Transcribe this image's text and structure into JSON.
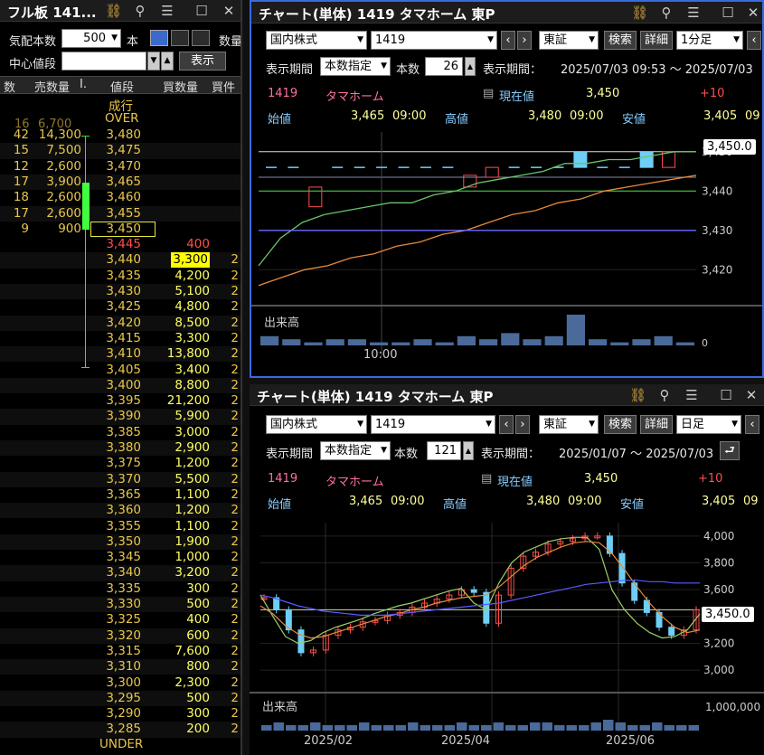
{
  "orderbook": {
    "title": "フル板 141...",
    "qty_label": "気配本数",
    "qty_value": "500",
    "unit_label": "本",
    "quantity_label": "数量",
    "center_label": "中心値段",
    "center_input": "",
    "display_button": "表示",
    "headers": [
      "数",
      "売数量",
      "I.",
      "値段",
      "買数量",
      "買件"
    ],
    "market_order_label": "成行",
    "over_label": "OVER",
    "under_label": "UNDER",
    "top_row": {
      "count": "16",
      "qty": "6,700"
    },
    "sell_rows": [
      {
        "count": "42",
        "qty": "14,300",
        "price": "3,480"
      },
      {
        "count": "15",
        "qty": "7,500",
        "price": "3,475"
      },
      {
        "count": "12",
        "qty": "2,600",
        "price": "3,470"
      },
      {
        "count": "17",
        "qty": "3,900",
        "price": "3,465"
      },
      {
        "count": "18",
        "qty": "2,600",
        "price": "3,460"
      },
      {
        "count": "17",
        "qty": "2,600",
        "price": "3,455"
      },
      {
        "count": "9",
        "qty": "900",
        "price": "3,450"
      }
    ],
    "buy_rows": [
      {
        "price": "3,445",
        "qty": "400"
      },
      {
        "price": "3,440",
        "qty": "3,300"
      },
      {
        "price": "3,435",
        "qty": "4,200"
      },
      {
        "price": "3,430",
        "qty": "5,100"
      },
      {
        "price": "3,425",
        "qty": "4,800"
      },
      {
        "price": "3,420",
        "qty": "8,500"
      },
      {
        "price": "3,415",
        "qty": "3,300"
      },
      {
        "price": "3,410",
        "qty": "13,800"
      },
      {
        "price": "3,405",
        "qty": "3,400"
      },
      {
        "price": "3,400",
        "qty": "8,800"
      },
      {
        "price": "3,395",
        "qty": "21,200"
      },
      {
        "price": "3,390",
        "qty": "5,900"
      },
      {
        "price": "3,385",
        "qty": "3,000"
      },
      {
        "price": "3,380",
        "qty": "2,900"
      },
      {
        "price": "3,375",
        "qty": "1,200"
      },
      {
        "price": "3,370",
        "qty": "5,500"
      },
      {
        "price": "3,365",
        "qty": "1,100"
      },
      {
        "price": "3,360",
        "qty": "1,200"
      },
      {
        "price": "3,355",
        "qty": "1,100"
      },
      {
        "price": "3,350",
        "qty": "1,900"
      },
      {
        "price": "3,345",
        "qty": "1,000"
      },
      {
        "price": "3,340",
        "qty": "3,200"
      },
      {
        "price": "3,335",
        "qty": "300"
      },
      {
        "price": "3,330",
        "qty": "500"
      },
      {
        "price": "3,325",
        "qty": "400"
      },
      {
        "price": "3,320",
        "qty": "600"
      },
      {
        "price": "3,315",
        "qty": "7,600"
      },
      {
        "price": "3,310",
        "qty": "800"
      },
      {
        "price": "3,300",
        "qty": "2,300"
      },
      {
        "price": "3,295",
        "qty": "500"
      },
      {
        "price": "3,290",
        "qty": "300"
      },
      {
        "price": "3,285",
        "qty": "200"
      }
    ]
  },
  "chart1": {
    "title": "チャート(単体) 1419 タマホーム 東P",
    "market": "国内株式",
    "code": "1419",
    "exchange": "東証",
    "search_btn": "検索",
    "detail_btn": "詳細",
    "interval": "1分足",
    "period_label": "表示期間",
    "period_mode": "本数指定",
    "count_label": "本数",
    "count_value": "26",
    "range_label": "表示期間：",
    "range_value": "2025/07/03 09:53 ～ 2025/07/03",
    "stock_code": "1419",
    "stock_name": "タマホーム",
    "current_label": "現在値",
    "current_value": "3,450",
    "change": "+10",
    "open_label": "始値",
    "open_value": "3,465",
    "open_time": "09:00",
    "high_label": "高値",
    "high_value": "3,480",
    "high_time": "09:00",
    "low_label": "安値",
    "low_value": "3,405",
    "low_time": "09",
    "price_tag": "3,450.0",
    "volume_label": "出来高",
    "time_label": "10:00"
  },
  "chart2": {
    "title": "チャート(単体) 1419 タマホーム 東P",
    "market": "国内株式",
    "code": "1419",
    "exchange": "東証",
    "search_btn": "検索",
    "detail_btn": "詳細",
    "interval": "日足",
    "period_label": "表示期間",
    "period_mode": "本数指定",
    "count_label": "本数",
    "count_value": "121",
    "range_label": "表示期間：",
    "range_value": "2025/01/07 ～ 2025/07/03",
    "stock_code": "1419",
    "stock_name": "タマホーム",
    "current_label": "現在値",
    "current_value": "3,450",
    "change": "+10",
    "open_label": "始値",
    "open_value": "3,465",
    "open_time": "09:00",
    "high_label": "高値",
    "high_value": "3,480",
    "high_time": "09:00",
    "low_label": "安値",
    "low_value": "3,405",
    "low_time": "09",
    "price_tag": "3,450.0",
    "volume_label": "出来高",
    "volume_tick": "1,000,000",
    "x_ticks": [
      "2025/02",
      "2025/04",
      "2025/06"
    ]
  },
  "colors": {
    "sell": "#e8c64a",
    "buy": "#ffff66",
    "up": "#ff4d4d",
    "down": "#6ecff6",
    "accent": "#ff6fa0"
  },
  "chart_data": [
    {
      "type": "line",
      "title": "",
      "ylim": [
        3415,
        3455
      ],
      "y_ticks": [
        3420,
        3430,
        3440,
        3450
      ],
      "x_tick_labels": [
        "10:00"
      ],
      "grid": true,
      "candles": [
        {
          "o": 3446,
          "c": 3446,
          "h": 3446,
          "l": 3446
        },
        {
          "o": 3446,
          "c": 3446,
          "h": 3446,
          "l": 3446
        },
        {
          "o": 3436,
          "c": 3441,
          "h": 3441,
          "l": 3436
        },
        {
          "o": 3446,
          "c": 3446,
          "h": 3446,
          "l": 3446
        },
        {
          "o": 3446,
          "c": 3446,
          "h": 3446,
          "l": 3446
        },
        {
          "o": 3446,
          "c": 3446,
          "h": 3446,
          "l": 3446
        },
        {
          "o": 3446,
          "c": 3446,
          "h": 3446,
          "l": 3446
        },
        {
          "o": 3446,
          "c": 3446,
          "h": 3446,
          "l": 3446
        },
        {
          "o": 3446,
          "c": 3446,
          "h": 3446,
          "l": 3446
        },
        {
          "o": 3441,
          "c": 3444,
          "h": 3444,
          "l": 3441
        },
        {
          "o": 3443.5,
          "c": 3446,
          "h": 3446,
          "l": 3443.5
        },
        {
          "o": 3446,
          "c": 3446,
          "h": 3446,
          "l": 3446
        },
        {
          "o": 3446,
          "c": 3446,
          "h": 3446,
          "l": 3446
        },
        {
          "o": 3446,
          "c": 3446,
          "h": 3446,
          "l": 3446
        },
        {
          "o": 3450,
          "c": 3446,
          "h": 3450,
          "l": 3446
        },
        {
          "o": 3446,
          "c": 3446,
          "h": 3446,
          "l": 3446
        },
        {
          "o": 3446,
          "c": 3446,
          "h": 3446,
          "l": 3446
        },
        {
          "o": 3450,
          "c": 3446,
          "h": 3450,
          "l": 3446
        },
        {
          "o": 3446,
          "c": 3450,
          "h": 3450,
          "l": 3446
        }
      ],
      "series": [
        {
          "values": [
            3421,
            3428,
            3432,
            3434,
            3435,
            3436,
            3437,
            3437,
            3439,
            3440,
            3442,
            3443,
            3444,
            3445,
            3447,
            3447,
            3448,
            3448,
            3449,
            3450,
            3450
          ],
          "color": "#6ac46a"
        },
        {
          "values": [
            3416,
            3418,
            3420,
            3421,
            3423,
            3424,
            3426,
            3427,
            3429,
            3430,
            3432,
            3434,
            3435,
            3437,
            3438,
            3440,
            3441,
            3442,
            3443,
            3444
          ],
          "color": "#e88a3a"
        },
        {
          "values": [
            3430,
            3430,
            3430,
            3430,
            3430,
            3430,
            3430,
            3430,
            3430,
            3430,
            3430,
            3430,
            3430,
            3430,
            3430,
            3430,
            3430,
            3430,
            3430,
            3430
          ],
          "color": "#6a6aff"
        }
      ],
      "volume": [
        3,
        2,
        1,
        2,
        2,
        1,
        1,
        2,
        1,
        3,
        2,
        4,
        2,
        3,
        10,
        2,
        1,
        2,
        3,
        1
      ]
    },
    {
      "type": "line",
      "title": "",
      "ylim": [
        2900,
        4100
      ],
      "y_ticks": [
        3000,
        3200,
        3400,
        3600,
        3800,
        4000
      ],
      "x_tick_labels": [
        "2025/02",
        "2025/04",
        "2025/06"
      ],
      "grid": true,
      "series": [
        {
          "name": "price",
          "values": [
            3540,
            3450,
            3300,
            3130,
            3150,
            3260,
            3300,
            3320,
            3360,
            3370,
            3410,
            3430,
            3470,
            3500,
            3530,
            3560,
            3600,
            3580,
            3350,
            3560,
            3760,
            3850,
            3880,
            3940,
            3960,
            3980,
            4000,
            4000,
            3870,
            3650,
            3520,
            3430,
            3320,
            3260,
            3300,
            3450
          ],
          "color": "#e8e8e8"
        },
        {
          "values": [
            3560,
            3400,
            3250,
            3200,
            3220,
            3280,
            3320,
            3350,
            3380,
            3420,
            3450,
            3480,
            3500,
            3530,
            3560,
            3590,
            3610,
            3500,
            3450,
            3650,
            3800,
            3880,
            3920,
            3960,
            3980,
            3990,
            3990,
            3900,
            3600,
            3450,
            3350,
            3280,
            3240,
            3250,
            3300,
            3420
          ],
          "color": "#9ad06a"
        },
        {
          "values": [
            3480,
            3420,
            3330,
            3270,
            3240,
            3250,
            3280,
            3310,
            3340,
            3370,
            3400,
            3420,
            3450,
            3470,
            3500,
            3520,
            3540,
            3550,
            3560,
            3620,
            3700,
            3780,
            3840,
            3880,
            3920,
            3950,
            3960,
            3950,
            3870,
            3750,
            3620,
            3500,
            3400,
            3320,
            3280,
            3300
          ],
          "color": "#e88a3a"
        },
        {
          "values": [
            3560,
            3540,
            3510,
            3480,
            3460,
            3440,
            3430,
            3420,
            3410,
            3410,
            3410,
            3420,
            3430,
            3440,
            3450,
            3460,
            3470,
            3480,
            3490,
            3500,
            3520,
            3540,
            3560,
            3580,
            3600,
            3620,
            3640,
            3650,
            3660,
            3670,
            3670,
            3660,
            3660,
            3650,
            3650,
            3650
          ],
          "color": "#5a5aff"
        }
      ],
      "volume": [
        2,
        3,
        2,
        2,
        3,
        2,
        2,
        2,
        3,
        2,
        2,
        2,
        3,
        2,
        2,
        2,
        3,
        2,
        2,
        3,
        2,
        2,
        3,
        3,
        2,
        2,
        2,
        3,
        4,
        3,
        2,
        2,
        3,
        2,
        2,
        2
      ]
    }
  ]
}
